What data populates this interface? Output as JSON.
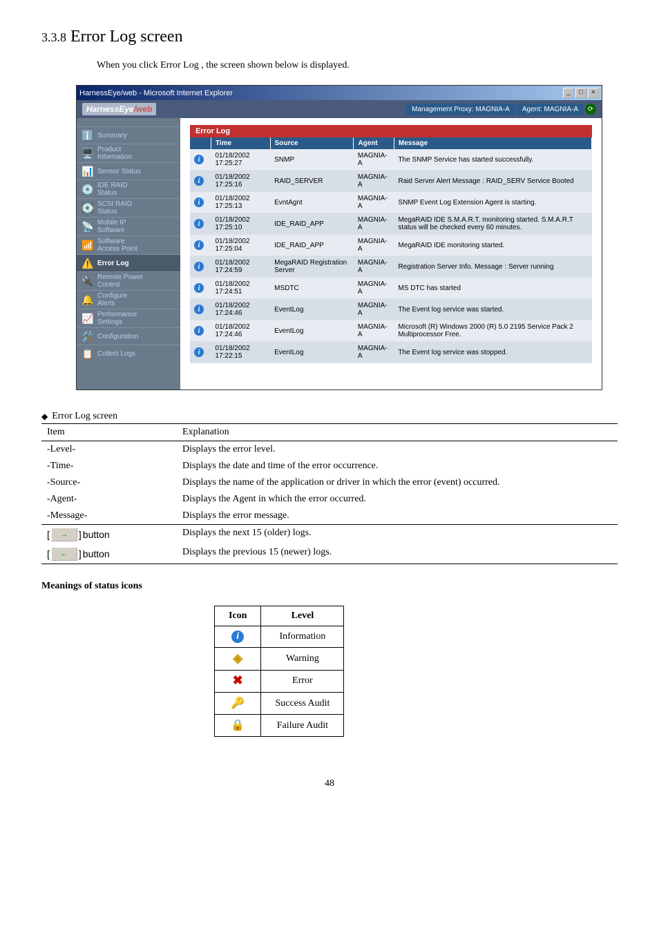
{
  "section": {
    "number": "3.3.8",
    "title": "Error Log screen"
  },
  "intro": "When you click Error Log , the screen shown below is displayed.",
  "window": {
    "title": "HarnessEye/web - Microsoft Internet Explorer",
    "app_name_a": "HarnessEye",
    "app_name_b": "/web",
    "proxy_label": "Management Proxy: MAGNIA-A",
    "agent_label": "Agent: MAGNIA-A"
  },
  "sidebar": {
    "items": [
      {
        "label": "Summary",
        "icon": "ℹ️"
      },
      {
        "label": "Product\nInformation",
        "icon": "🖥️"
      },
      {
        "label": "Sensor Status",
        "icon": "📊"
      },
      {
        "label": "IDE RAID\nStatus",
        "icon": "💿"
      },
      {
        "label": "SCSI RAID\nStatus",
        "icon": "💽"
      },
      {
        "label": "Mobile IP\nSoftware",
        "icon": "📡"
      },
      {
        "label": "Software\nAccess Point",
        "icon": "📶"
      },
      {
        "label": "Error Log",
        "icon": "⚠️",
        "active": true
      },
      {
        "label": "Remote Power\nControl",
        "icon": "🔌"
      },
      {
        "label": "Configure\nAlerts",
        "icon": "🔔"
      },
      {
        "label": "Performance\nSettings",
        "icon": "📈"
      },
      {
        "label": "Configuration",
        "icon": "🛠️"
      },
      {
        "label": "Collect Logs",
        "icon": "📋"
      }
    ]
  },
  "panel": {
    "title": "Error Log"
  },
  "log_headers": {
    "time": "Time",
    "source": "Source",
    "agent": "Agent",
    "message": "Message"
  },
  "logs": [
    {
      "time": "01/18/2002 17:25:27",
      "source": "SNMP",
      "agent": "MAGNIA-A",
      "message": "The SNMP Service has started successfully."
    },
    {
      "time": "01/18/2002 17:25:16",
      "source": "RAID_SERVER",
      "agent": "MAGNIA-A",
      "message": "Raid Server Alert Message : RAID_SERV Service Booted"
    },
    {
      "time": "01/18/2002 17:25:13",
      "source": "EvntAgnt",
      "agent": "MAGNIA-A",
      "message": "SNMP Event Log Extension Agent is starting."
    },
    {
      "time": "01/18/2002 17:25:10",
      "source": "IDE_RAID_APP",
      "agent": "MAGNIA-A",
      "message": "MegaRAID IDE S.M.A.R.T. monitoring started. S.M.A.R.T status will be checked every 60 minutes."
    },
    {
      "time": "01/18/2002 17:25:04",
      "source": "IDE_RAID_APP",
      "agent": "MAGNIA-A",
      "message": "MegaRAID IDE monitoring started."
    },
    {
      "time": "01/18/2002 17:24:59",
      "source": "MegaRAID Registration Server",
      "agent": "MAGNIA-A",
      "message": "Registration Server Info. Message : Server running"
    },
    {
      "time": "01/18/2002 17:24:51",
      "source": "MSDTC",
      "agent": "MAGNIA-A",
      "message": "MS DTC has started"
    },
    {
      "time": "01/18/2002 17:24:46",
      "source": "EventLog",
      "agent": "MAGNIA-A",
      "message": "The Event log service was started."
    },
    {
      "time": "01/18/2002 17:24:46",
      "source": "EventLog",
      "agent": "MAGNIA-A",
      "message": "Microsoft (R) Windows 2000 (R) 5.0 2195 Service Pack 2 Multiprocessor Free."
    },
    {
      "time": "01/18/2002 17:22:15",
      "source": "EventLog",
      "agent": "MAGNIA-A",
      "message": "The Event log service was stopped."
    }
  ],
  "legend": {
    "header": "Error Log screen",
    "col_item": "Item",
    "col_expl": "Explanation",
    "rows": [
      {
        "item": "-Level-",
        "expl": "Displays the error level."
      },
      {
        "item": "-Time-",
        "expl": "Displays the date and time of the error occurrence."
      },
      {
        "item": "-Source-",
        "expl": "Displays the name of the application or driver in which the error (event) occurred."
      },
      {
        "item": "-Agent-",
        "expl": "Displays the Agent in which the error occurred."
      },
      {
        "item": "-Message-",
        "expl": "Displays the error message."
      }
    ],
    "next_btn": {
      "label": "button",
      "expl": "Displays the next 15 (older) logs."
    },
    "prev_btn": {
      "label": "button",
      "expl": "Displays the previous 15 (newer) logs."
    }
  },
  "meanings": {
    "header": "Meanings of status icons",
    "col_icon": "Icon",
    "col_level": "Level",
    "levels": [
      {
        "label": "Information"
      },
      {
        "label": "Warning"
      },
      {
        "label": "Error"
      },
      {
        "label": "Success Audit"
      },
      {
        "label": "Failure Audit"
      }
    ]
  },
  "page_number": "48"
}
